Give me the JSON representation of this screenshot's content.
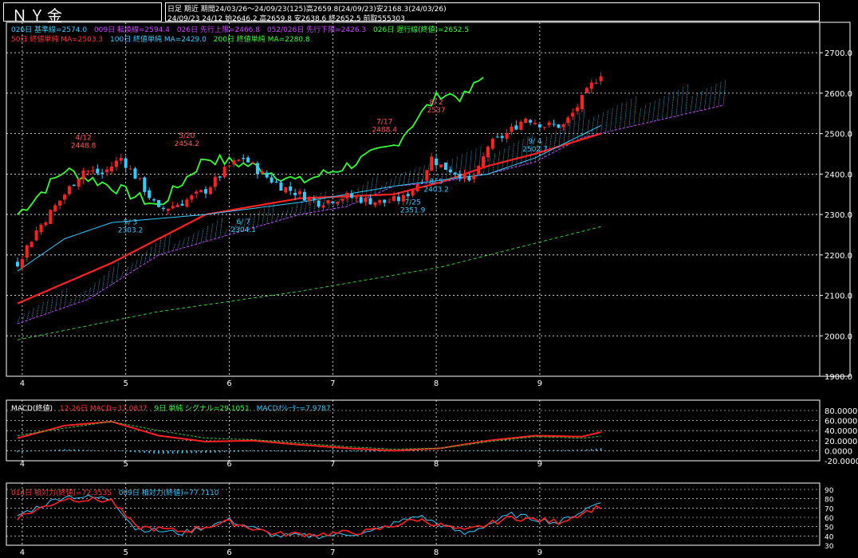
{
  "header": {
    "title": "ＮＹ金",
    "line1": "日足 期近 期間24/03/26～24/09/23(125)高2659.8(24/09/23)安2168.3(24/03/26)",
    "line2": "24/09/23 24/12 始2646.2 高2659.8 安2638.6 終2652.5 前取555303"
  },
  "legend": {
    "row1": [
      {
        "text": "026日 基準線=2574.0",
        "color": "#33ccff"
      },
      {
        "text": "009日 転換線=2594.4",
        "color": "#cc44ff"
      },
      {
        "text": "026日 先行上限=2466.8",
        "color": "#cc44ff"
      },
      {
        "text": "052/026日 先行下限=2426.3",
        "color": "#cc44ff"
      },
      {
        "text": "026日 遅行線(終値)=2652.5",
        "color": "#33ff33"
      }
    ],
    "row2": [
      {
        "text": "50日 終値単純 MA=2503.3",
        "color": "#ff3333"
      },
      {
        "text": "100日 終値単純 MA=2429.0",
        "color": "#33ccff"
      },
      {
        "text": "200日 終値単純 MA=2280.8",
        "color": "#33ff33"
      }
    ],
    "macd": [
      {
        "text": "MACD(終値)",
        "color": "#ffffff"
      },
      {
        "text": "12-26日 MACD=37.0837",
        "color": "#ff3333"
      },
      {
        "text": "9日 単純 シグナル=29.1051",
        "color": "#33ff33"
      },
      {
        "text": "MACDｵｼﾚｰﾀｰ=7.9787",
        "color": "#33ccff"
      }
    ],
    "rsi": [
      {
        "text": "014日 相対力(終値)=72.3535",
        "color": "#ff3333"
      },
      {
        "text": "009日 相対力(終値)=77.7110",
        "color": "#33ccff"
      }
    ]
  },
  "annotations": [
    {
      "date": "4/12",
      "value": "2448.8"
    },
    {
      "date": "5/20",
      "value": "2454.2"
    },
    {
      "date": "5/ 3",
      "value": "2303.2"
    },
    {
      "date": "6/ 7",
      "value": "2304.1"
    },
    {
      "date": "7/17",
      "value": "2488.4"
    },
    {
      "date": "7/25",
      "value": "2351.9"
    },
    {
      "date": "8/ 2",
      "value": "2537"
    },
    {
      "date": "8/ 5",
      "value": "2403.2"
    },
    {
      "date": "9/ 4",
      "value": "2502.7"
    }
  ],
  "colors": {
    "up": "#ff2222",
    "down": "#33ccff",
    "ma50": "#ff2222",
    "ma100": "#33ccff",
    "ma200": "#33cc33",
    "chikou": "#33ff33",
    "kijun": "#33ccff",
    "tenkan": "#ff3333",
    "cloud": "#cc44ff"
  },
  "chart_data": [
    {
      "type": "candlestick",
      "title": "ＮＹ金 日足",
      "x_month_labels": [
        "4",
        "5",
        "6",
        "7",
        "8",
        "9"
      ],
      "ylim": [
        1900,
        2720
      ],
      "y_ticks": [
        "2700.0",
        "2600.0",
        "2500.0",
        "2400.0",
        "2300.0",
        "2200.0",
        "2100.0",
        "2000.0",
        "1900.0"
      ],
      "candles_approx": {
        "count": 125,
        "start_close": 2180,
        "end_close": 2652.5,
        "path": [
          [
            0,
            2180
          ],
          [
            4,
            2260
          ],
          [
            8,
            2320
          ],
          [
            14,
            2410
          ],
          [
            18,
            2400
          ],
          [
            22,
            2440
          ],
          [
            26,
            2380
          ],
          [
            30,
            2310
          ],
          [
            35,
            2330
          ],
          [
            40,
            2360
          ],
          [
            45,
            2420
          ],
          [
            48,
            2440
          ],
          [
            52,
            2400
          ],
          [
            56,
            2370
          ],
          [
            60,
            2350
          ],
          [
            64,
            2330
          ],
          [
            70,
            2345
          ],
          [
            74,
            2335
          ],
          [
            78,
            2330
          ],
          [
            82,
            2340
          ],
          [
            86,
            2390
          ],
          [
            88,
            2440
          ],
          [
            90,
            2420
          ],
          [
            94,
            2400
          ],
          [
            96,
            2380
          ],
          [
            98,
            2410
          ],
          [
            100,
            2470
          ],
          [
            104,
            2500
          ],
          [
            106,
            2520
          ],
          [
            108,
            2540
          ],
          [
            112,
            2520
          ],
          [
            116,
            2520
          ],
          [
            118,
            2550
          ],
          [
            122,
            2620
          ],
          [
            124,
            2650
          ]
        ]
      },
      "series": [
        {
          "name": "50日 終値単純 MA",
          "points": [
            [
              0,
              2080
            ],
            [
              20,
              2180
            ],
            [
              40,
              2300
            ],
            [
              60,
              2340
            ],
            [
              80,
              2350
            ],
            [
              90,
              2380
            ],
            [
              100,
              2420
            ],
            [
              110,
              2450
            ],
            [
              124,
              2500
            ]
          ]
        },
        {
          "name": "100日 終値単純 MA",
          "points": [
            [
              0,
              2160
            ],
            [
              10,
              2240
            ],
            [
              20,
              2280
            ],
            [
              40,
              2300
            ],
            [
              60,
              2330
            ],
            [
              80,
              2370
            ],
            [
              100,
              2400
            ],
            [
              110,
              2440
            ],
            [
              124,
              2520
            ]
          ]
        },
        {
          "name": "200日 終値単純 MA",
          "points": [
            [
              0,
              1990
            ],
            [
              30,
              2060
            ],
            [
              60,
              2110
            ],
            [
              90,
              2170
            ],
            [
              124,
              2270
            ]
          ]
        },
        {
          "name": "遅行線",
          "points": [
            [
              0,
              2300
            ],
            [
              10,
              2410
            ],
            [
              20,
              2370
            ],
            [
              30,
              2320
            ],
            [
              40,
              2440
            ],
            [
              50,
              2420
            ],
            [
              60,
              2380
            ],
            [
              70,
              2420
            ],
            [
              80,
              2470
            ],
            [
              85,
              2540
            ],
            [
              90,
              2600
            ],
            [
              95,
              2590
            ],
            [
              99,
              2640
            ]
          ]
        }
      ]
    },
    {
      "type": "line",
      "title": "MACD(終値)",
      "ylim": [
        -20,
        80
      ],
      "y_ticks": [
        "80.0000",
        "60.0000",
        "40.0000",
        "20.0000",
        "0.0000",
        "-20.0000"
      ],
      "series": [
        {
          "name": "MACD",
          "points": [
            [
              0,
              25
            ],
            [
              10,
              50
            ],
            [
              20,
              58
            ],
            [
              30,
              30
            ],
            [
              40,
              18
            ],
            [
              50,
              20
            ],
            [
              60,
              12
            ],
            [
              70,
              5
            ],
            [
              80,
              0
            ],
            [
              90,
              5
            ],
            [
              100,
              20
            ],
            [
              110,
              30
            ],
            [
              120,
              28
            ],
            [
              124,
              37
            ]
          ]
        },
        {
          "name": "シグナル",
          "points": [
            [
              0,
              30
            ],
            [
              10,
              45
            ],
            [
              20,
              58
            ],
            [
              30,
              40
            ],
            [
              40,
              25
            ],
            [
              50,
              22
            ],
            [
              60,
              15
            ],
            [
              70,
              8
            ],
            [
              80,
              3
            ],
            [
              90,
              5
            ],
            [
              100,
              18
            ],
            [
              110,
              28
            ],
            [
              120,
              25
            ],
            [
              124,
              29
            ]
          ]
        }
      ]
    },
    {
      "type": "line",
      "title": "相対力(終値)",
      "ylim": [
        30,
        90
      ],
      "y_ticks": [
        "90",
        "80",
        "70",
        "60",
        "50",
        "40",
        "30"
      ],
      "series": [
        {
          "name": "014日 相対力",
          "points": [
            [
              0,
              60
            ],
            [
              10,
              80
            ],
            [
              20,
              78
            ],
            [
              25,
              50
            ],
            [
              35,
              45
            ],
            [
              45,
              55
            ],
            [
              55,
              42
            ],
            [
              65,
              42
            ],
            [
              75,
              45
            ],
            [
              85,
              58
            ],
            [
              95,
              45
            ],
            [
              105,
              60
            ],
            [
              115,
              55
            ],
            [
              124,
              72
            ]
          ]
        },
        {
          "name": "009日 相対力",
          "points": [
            [
              0,
              62
            ],
            [
              10,
              83
            ],
            [
              20,
              80
            ],
            [
              25,
              48
            ],
            [
              35,
              43
            ],
            [
              45,
              57
            ],
            [
              55,
              40
            ],
            [
              65,
              40
            ],
            [
              75,
              44
            ],
            [
              85,
              62
            ],
            [
              95,
              42
            ],
            [
              105,
              63
            ],
            [
              115,
              54
            ],
            [
              124,
              77
            ]
          ]
        }
      ]
    }
  ]
}
